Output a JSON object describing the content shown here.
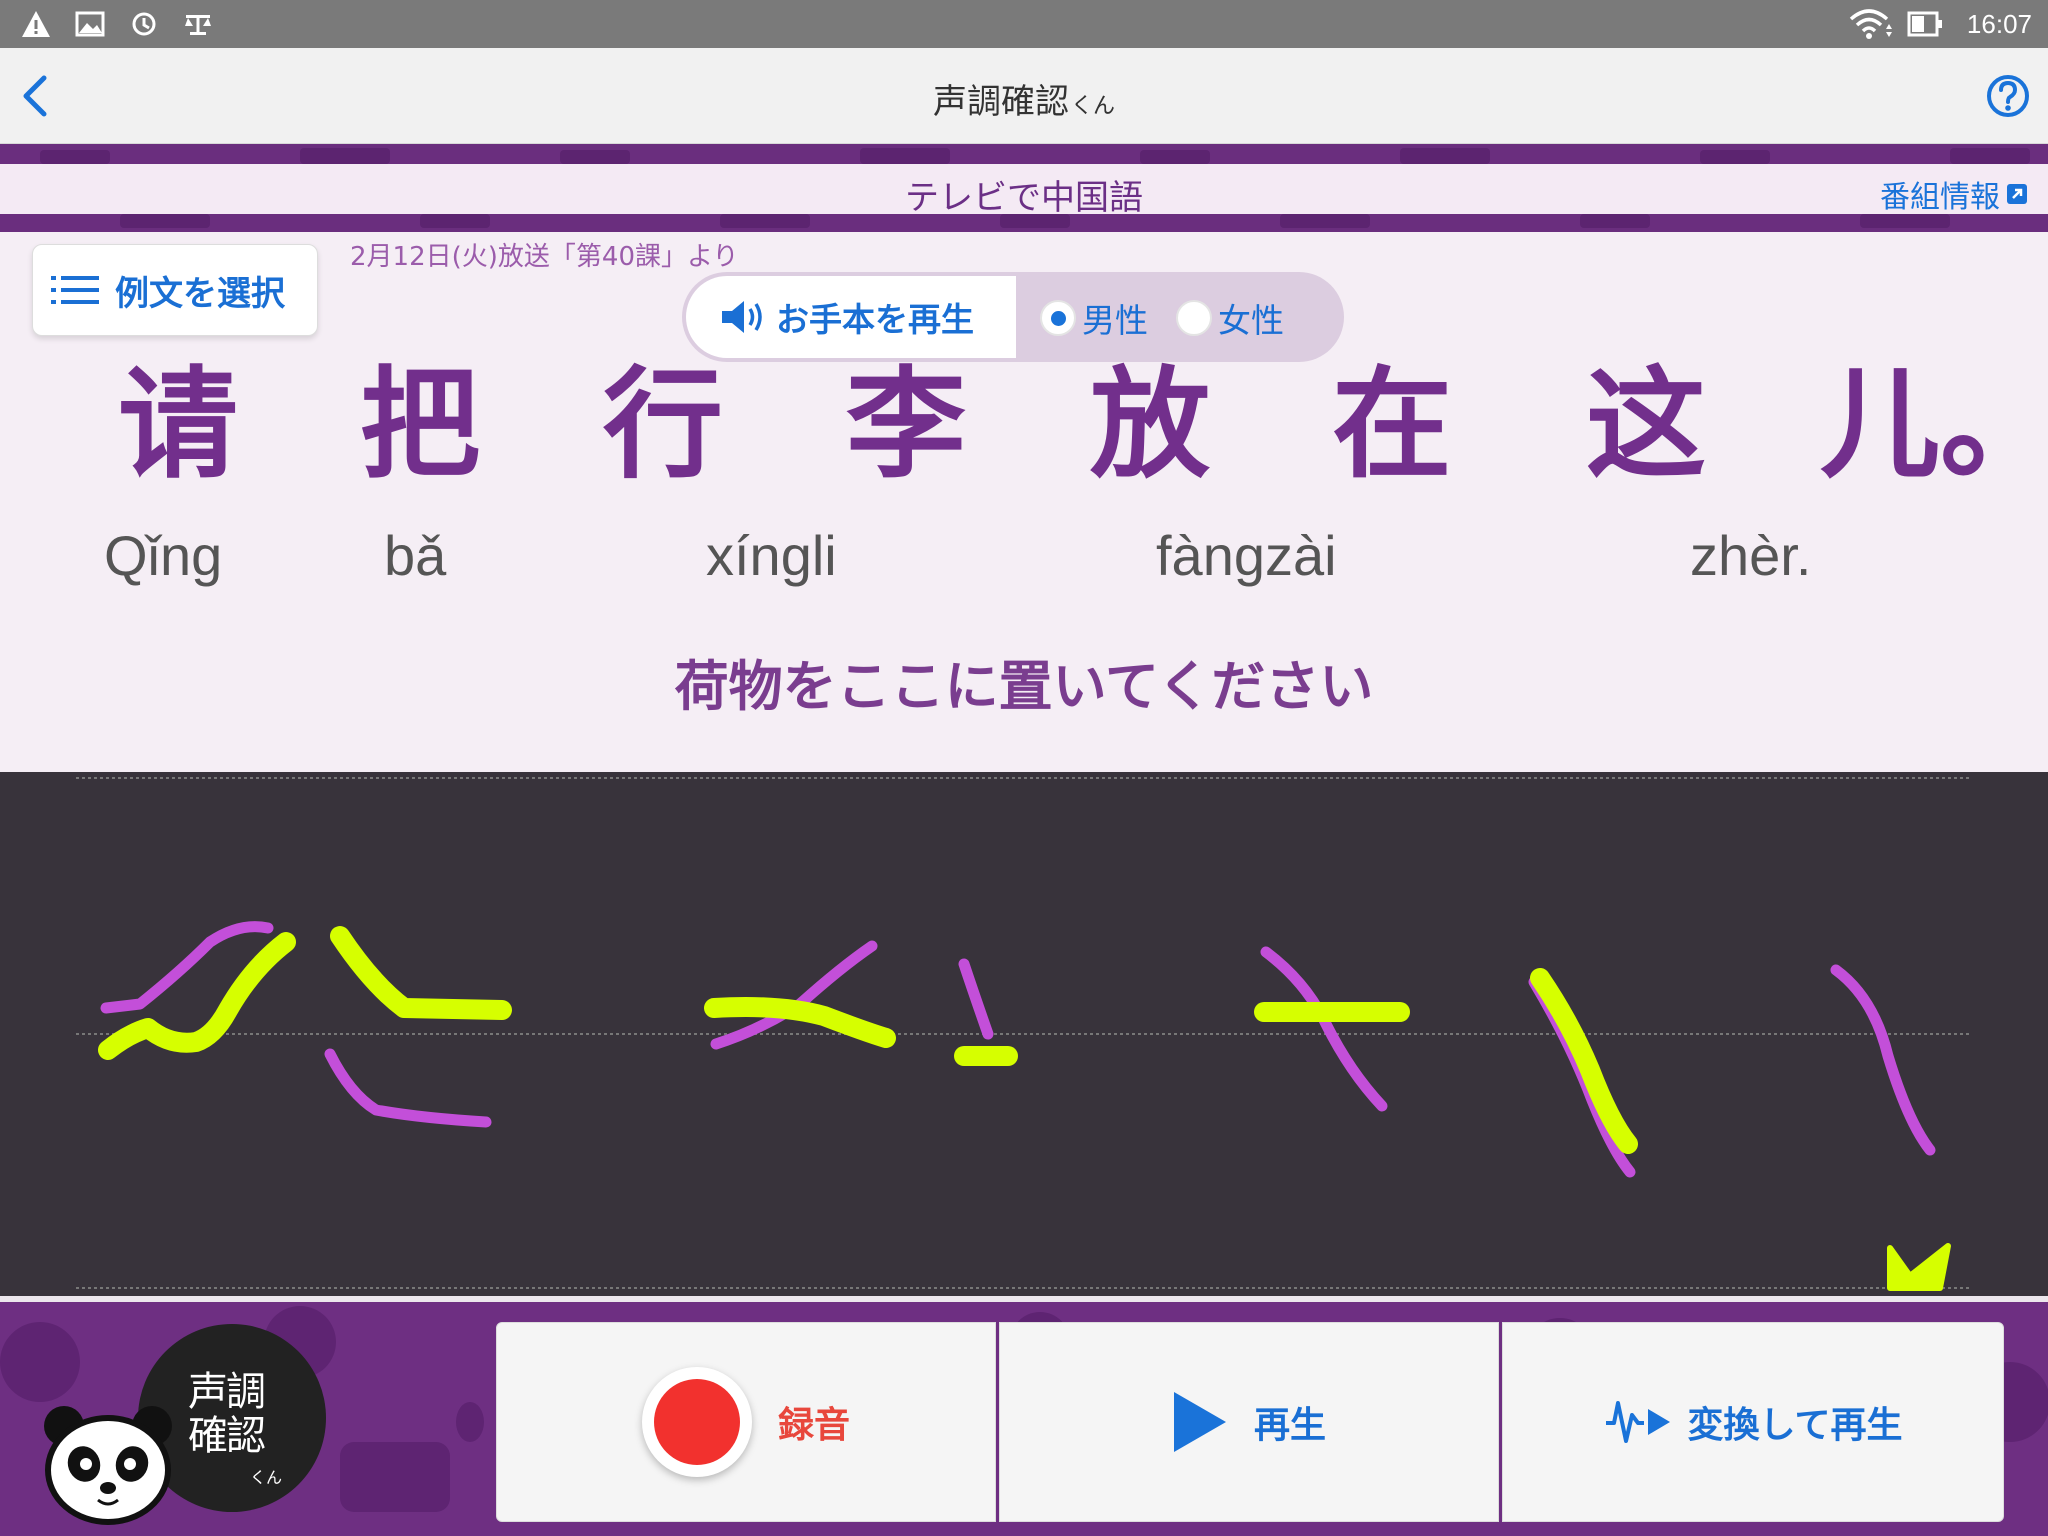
{
  "status": {
    "time": "16:07"
  },
  "header": {
    "title": "声調確認",
    "title_suffix": "くん"
  },
  "program": {
    "title": "テレビで中国語",
    "info_link": "番組情報"
  },
  "content": {
    "select_button": "例文を選択",
    "broadcast": "2月12日(火)放送「第40課」より",
    "play_sample": "お手本を再生",
    "voice_options": [
      {
        "label": "男性",
        "selected": true
      },
      {
        "label": "女性",
        "selected": false
      }
    ],
    "hanzi": [
      "请",
      "把",
      "行",
      "李",
      "放",
      "在",
      "这",
      "儿。"
    ],
    "pinyin": [
      "Qǐng",
      "bǎ",
      "xíngli",
      "fàngzài",
      "zhèr."
    ],
    "translation": "荷物をここに置いてください"
  },
  "colors": {
    "accent": "#722f8c",
    "link": "#1a73d9",
    "model_curve": "#c34fd9",
    "user_curve": "#d6ff00",
    "record": "#f2312e"
  },
  "bottom": {
    "logo_line1": "声調",
    "logo_line2": "確認",
    "logo_suffix": "くん",
    "record_label": "録音",
    "play_label": "再生",
    "convert_label": "変換して再生"
  }
}
